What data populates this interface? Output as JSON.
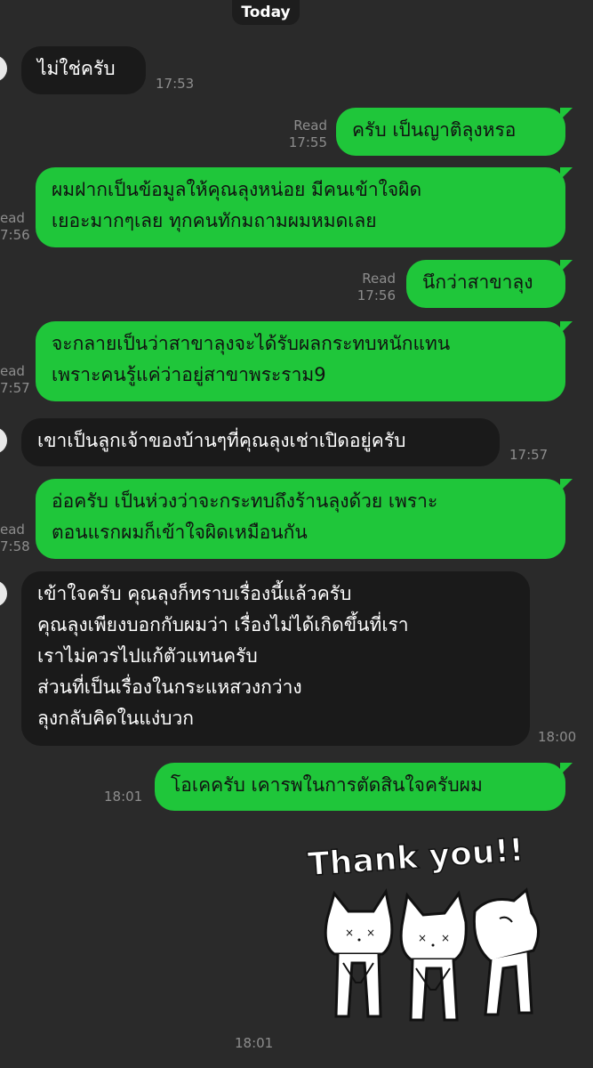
{
  "header": {
    "date_label": "Today"
  },
  "messages": [
    {
      "text": "ไม่ใช่ครับ",
      "time": "17:53"
    },
    {
      "text": "ครับ เป็นญาติลุงหรอ",
      "read": "Read",
      "time": "17:55"
    },
    {
      "text": "ผมฝากเป็นข้อมูลให้คุณลุงหน่อย มีคนเข้าใจผิด\nเยอะมากๆเลย ทุกคนทักมถามผมหมดเลย",
      "read": "ead",
      "time": "7:56"
    },
    {
      "text": "นึกว่าสาขาลุง",
      "read": "Read",
      "time": "17:56"
    },
    {
      "text": "จะกลายเป็นว่าสาขาลุงจะได้รับผลกระทบหนักแทน\nเพราะคนรู้แค่ว่าอยู่สาขาพระราม9",
      "read": "ead",
      "time": "7:57"
    },
    {
      "text": "เขาเป็นลูกเจ้าของบ้านๆที่คุณลุงเช่าเปิดอยู่ครับ",
      "time": "17:57"
    },
    {
      "text": "อ่อครับ เป็นห่วงว่าจะกระทบถึงร้านลุงด้วย เพราะ\nตอนแรกผมก็เข้าใจผิดเหมือนกัน",
      "read": "ead",
      "time": "7:58"
    },
    {
      "text": "เข้าใจครับ คุณลุงก็ทราบเรื่องนี้แล้วครับ\nคุณลุงเพียงบอกกับผมว่า เรื่องไม่ได้เกิดขึ้นที่เรา\nเราไม่ควรไปแก้ตัวแทนครับ\nส่วนที่เป็นเรื่องในกระแหสวงกว่าง\nลุงกลับคิดในแง่บวก",
      "time": "18:00"
    },
    {
      "text": "โอเคครับ เคารพในการตัดสินใจครับผม",
      "time": "18:01"
    }
  ],
  "sticker": {
    "caption": "Thank you!!",
    "time": "18:01"
  },
  "colors": {
    "background": "#2a2a2a",
    "incoming_bubble": "#1a1a1a",
    "outgoing_bubble": "#1fc63a",
    "meta_text": "#8d8d8d"
  }
}
